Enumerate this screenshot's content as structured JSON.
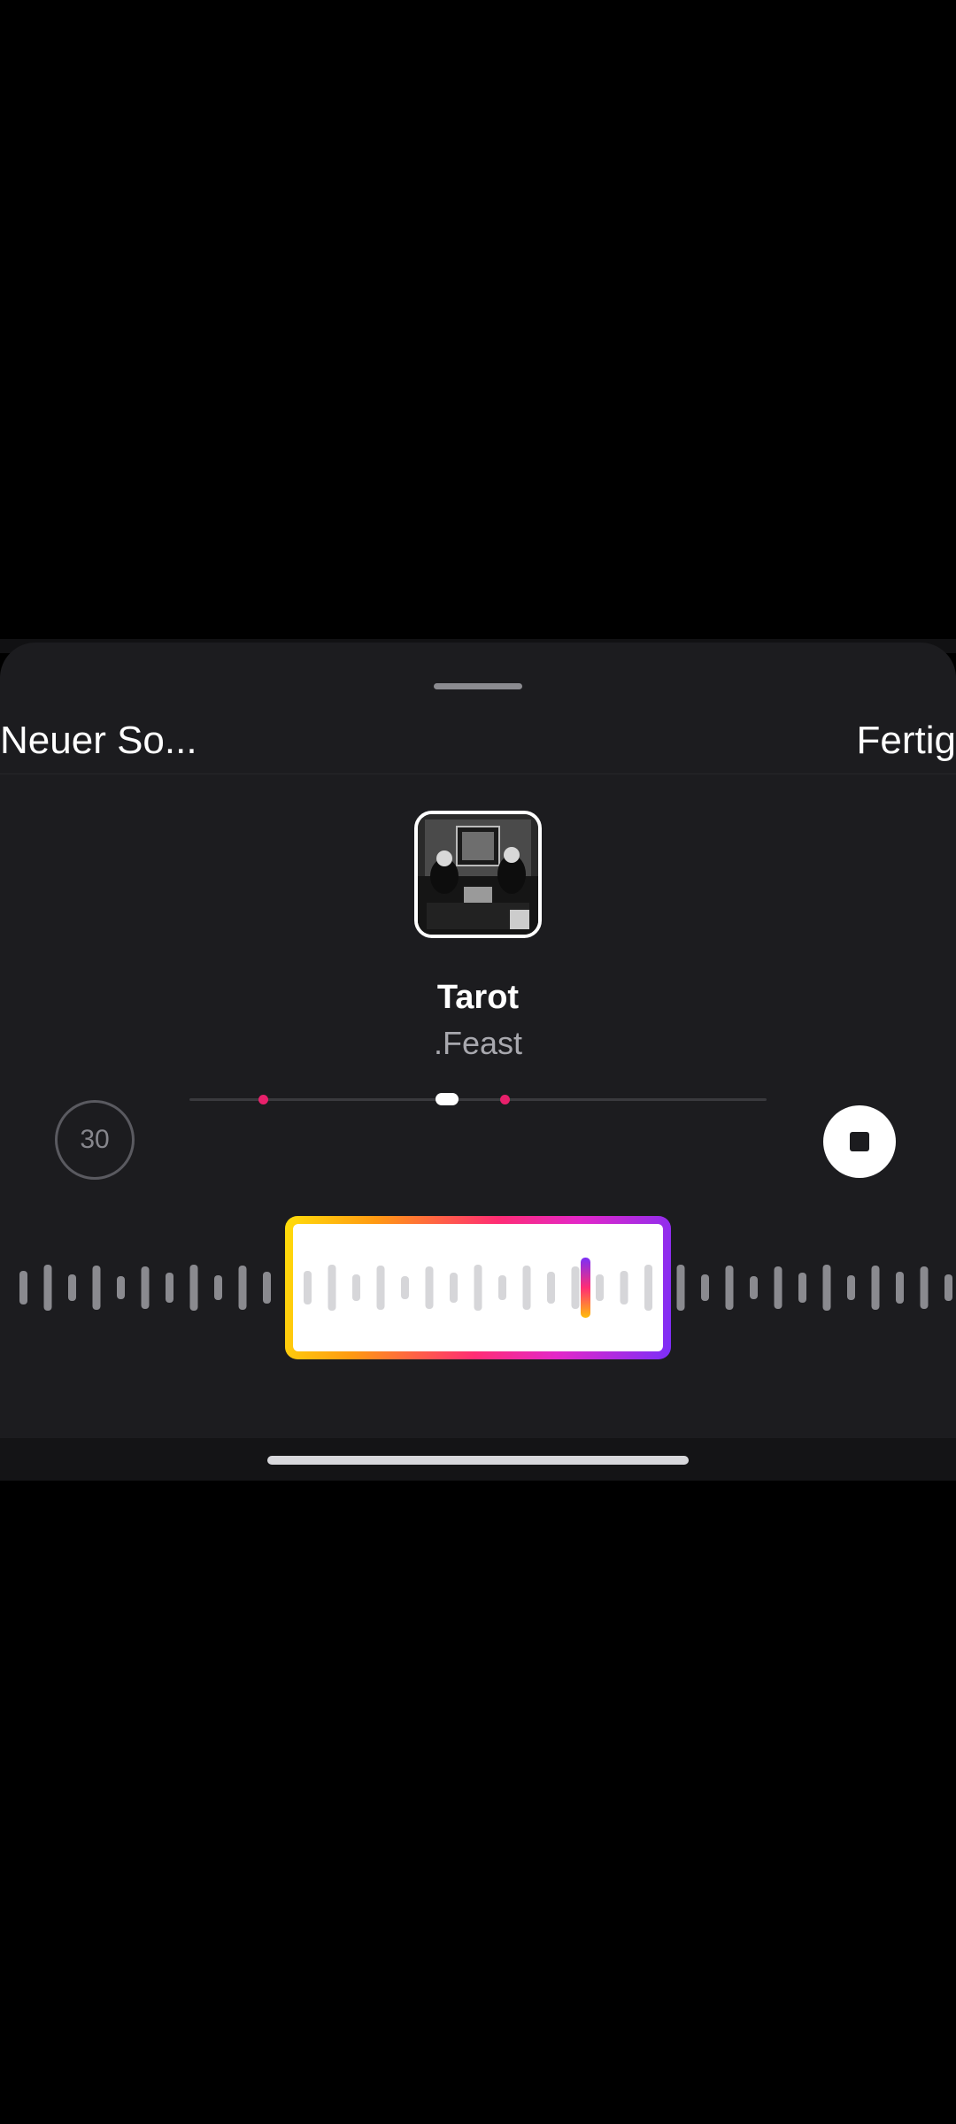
{
  "header": {
    "left_label": "Neuer So...",
    "right_label": "Fertig"
  },
  "song": {
    "title": "Tarot",
    "artist": ".Feast"
  },
  "player": {
    "duration_label": "30",
    "position_fraction": 0.44
  },
  "colors": {
    "sheet_bg": "#1c1c1f",
    "marker": "#e8206b",
    "gradient": [
      "#ffde0a",
      "#ff9a12",
      "#ff2d74",
      "#e327c8",
      "#7b2ff7"
    ]
  },
  "icons": [
    "stop-icon"
  ]
}
